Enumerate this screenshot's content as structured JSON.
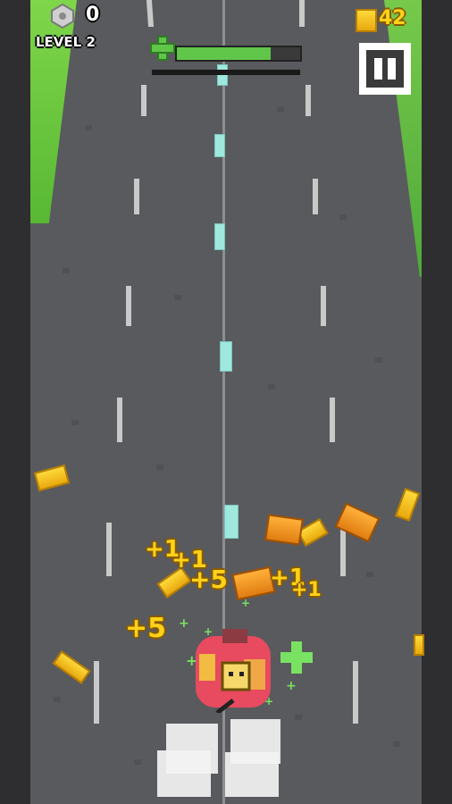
{
  "hud": {
    "bolt_count": "0",
    "level_label": "LEVEL 2",
    "coin_count": "42",
    "health_fraction": 0.76,
    "health_icon": "plus-icon",
    "pause_icon": "pause-icon"
  },
  "floaters": {
    "plus1_a": "+1",
    "plus1_b": "+1",
    "plus5_a": "+5",
    "plus5_b": "+5",
    "plus1_c": "+1",
    "plus1_d": "+1"
  },
  "colors": {
    "road": "#595a5d",
    "grass": "#6cc843",
    "health": "#5fc64a",
    "gold": "#ffd21a",
    "player": "#e84a5f"
  }
}
